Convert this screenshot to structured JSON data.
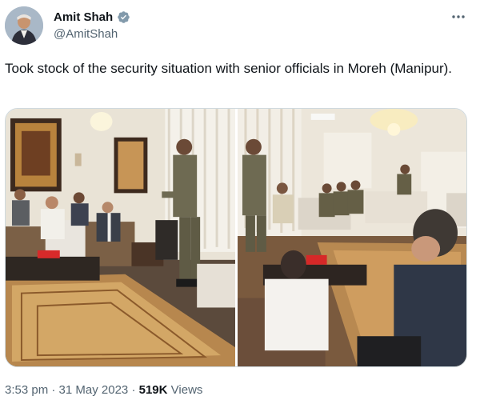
{
  "author": {
    "display_name": "Amit Shah",
    "handle": "@AmitShah",
    "verified_badge": "verified-badge-icon"
  },
  "menu_icon": "more-icon",
  "tweet": {
    "text": "Took stock of the security situation with senior officials in Moreh (Manipur)."
  },
  "media": {
    "count": 2
  },
  "meta": {
    "time": "3:53 pm",
    "separator1": "·",
    "date": "31 May 2023",
    "separator2": "·",
    "views_count": "519K",
    "views_label": "Views"
  },
  "colors": {
    "verified_badge": "#829aab",
    "secondary_text": "#536471",
    "primary_text": "#0f1419"
  }
}
